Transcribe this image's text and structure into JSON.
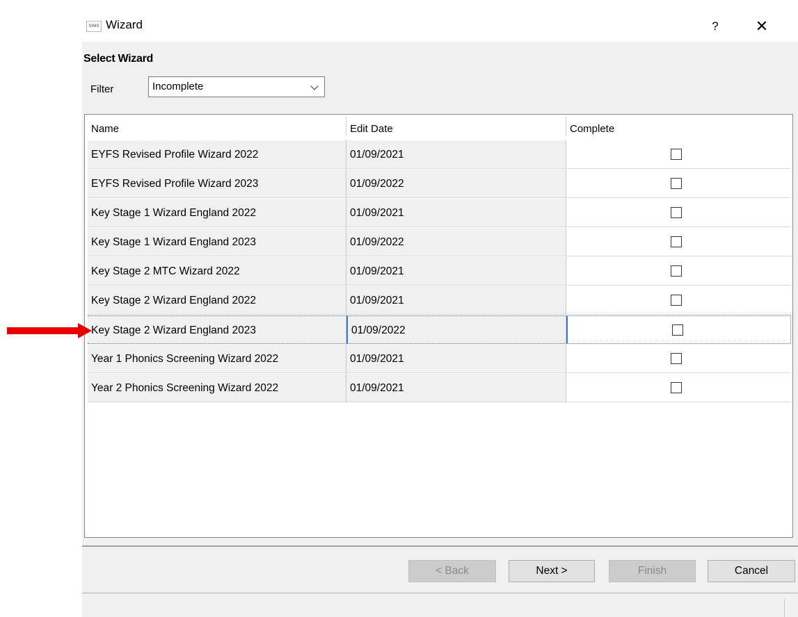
{
  "window": {
    "app_icon_text": "SIMS",
    "title": "Wizard",
    "help_label": "?",
    "close_label": "✕"
  },
  "section_title": "Select Wizard",
  "filter": {
    "label": "Filter",
    "value": "Incomplete"
  },
  "grid": {
    "columns": [
      "Name",
      "Edit Date",
      "Complete"
    ],
    "rows": [
      {
        "name": "EYFS Revised Profile Wizard 2022",
        "edit_date": "01/09/2021",
        "complete": false
      },
      {
        "name": "EYFS Revised Profile Wizard 2023",
        "edit_date": "01/09/2022",
        "complete": false
      },
      {
        "name": "Key Stage 1 Wizard England 2022",
        "edit_date": "01/09/2021",
        "complete": false
      },
      {
        "name": "Key Stage 1 Wizard England 2023",
        "edit_date": "01/09/2022",
        "complete": false
      },
      {
        "name": "Key Stage 2 MTC Wizard 2022",
        "edit_date": "01/09/2021",
        "complete": false
      },
      {
        "name": "Key Stage 2 Wizard England 2022",
        "edit_date": "01/09/2021",
        "complete": false
      },
      {
        "name": "Key Stage 2 Wizard England 2023",
        "edit_date": "01/09/2022",
        "complete": false
      },
      {
        "name": "Year 1 Phonics Screening Wizard 2022",
        "edit_date": "01/09/2021",
        "complete": false
      },
      {
        "name": "Year 2 Phonics Screening Wizard 2022",
        "edit_date": "01/09/2021",
        "complete": false
      }
    ],
    "selected_row_index": 6
  },
  "buttons": {
    "back": "< Back",
    "next": "Next >",
    "finish": "Finish",
    "cancel": "Cancel"
  },
  "annotation": {
    "arrow_color": "#e60000"
  }
}
